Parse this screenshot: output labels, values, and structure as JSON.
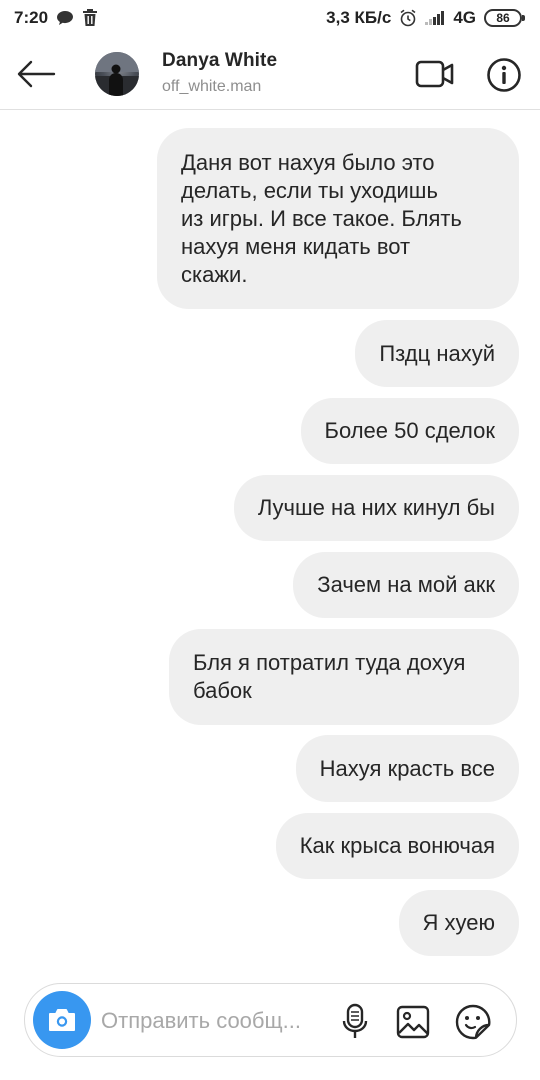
{
  "status_bar": {
    "time": "7:20",
    "net_speed": "3,3 КБ/с",
    "network": "4G",
    "battery": "86"
  },
  "header": {
    "name": "Danya White",
    "username": "off_white.man"
  },
  "messages": [
    {
      "text": "Даня вот нахуя было это\nделать, если ты уходишь\nиз игры. И все такое. Блять\nнахуя меня кидать вот\nскажи."
    },
    {
      "text": "Пздц нахуй"
    },
    {
      "text": "Более 50 сделок"
    },
    {
      "text": "Лучше на них кинул бы"
    },
    {
      "text": "Зачем на мой акк"
    },
    {
      "text": "Бля я потратил туда дохуя\nбабок"
    },
    {
      "text": "Нахуя красть все"
    },
    {
      "text": "Как крыса вонючая"
    },
    {
      "text": "Я хуею"
    }
  ],
  "composer": {
    "placeholder": "Отправить сообщ..."
  },
  "colors": {
    "bubble": "#efefef",
    "accent": "#3897f0",
    "muted": "#8e8e8e"
  },
  "icons": [
    "back-arrow-icon",
    "video-call-icon",
    "info-icon",
    "camera-icon",
    "microphone-icon",
    "gallery-icon",
    "sticker-icon"
  ]
}
